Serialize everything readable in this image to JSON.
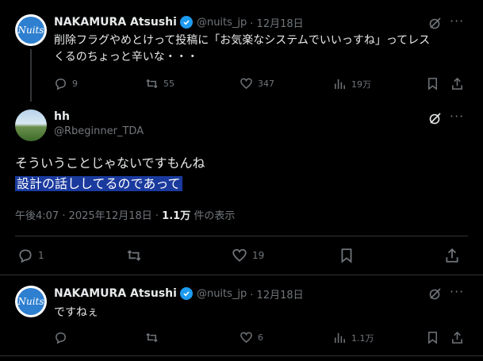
{
  "post1": {
    "name": "NAKAMURA Atsushi",
    "handle": "@nuits_jp",
    "date": "· 12月18日",
    "avatar_text": "Nuits",
    "text_line1": "削除フラグやめとけって投稿に「お気楽なシステムでいいっすね」ってレス",
    "text_line2": "くるのちょっと辛いな・・・",
    "replies": "9",
    "reposts": "55",
    "likes": "347",
    "views": "19万"
  },
  "post2": {
    "name": "hh",
    "handle": "@Rbeginner_TDA",
    "line1": "そういうことじゃないですもんね",
    "line2": "設計の話ししてるのであって",
    "timestamp": "午後4:07 · 2025年12月18日 ·",
    "view_count": "1.1万",
    "view_label": "件の表示",
    "replies": "1",
    "likes": "19"
  },
  "post3": {
    "name": "NAKAMURA Atsushi",
    "handle": "@nuits_jp",
    "date": "· 12月18日",
    "avatar_text": "Nuits",
    "text": "ですねぇ",
    "likes": "6",
    "views": "1.1万"
  },
  "colors": {
    "background": "#000000",
    "text_primary": "#e7e9ea",
    "text_secondary": "#71767b",
    "verified_blue": "#1d9bf0",
    "selection_highlight": "#1a3a9e",
    "divider": "#2f3336"
  },
  "icons": [
    "verified-badge-icon",
    "grok-icon",
    "more-icon",
    "reply-icon",
    "repost-icon",
    "like-icon",
    "views-icon",
    "bookmark-icon",
    "share-icon"
  ]
}
